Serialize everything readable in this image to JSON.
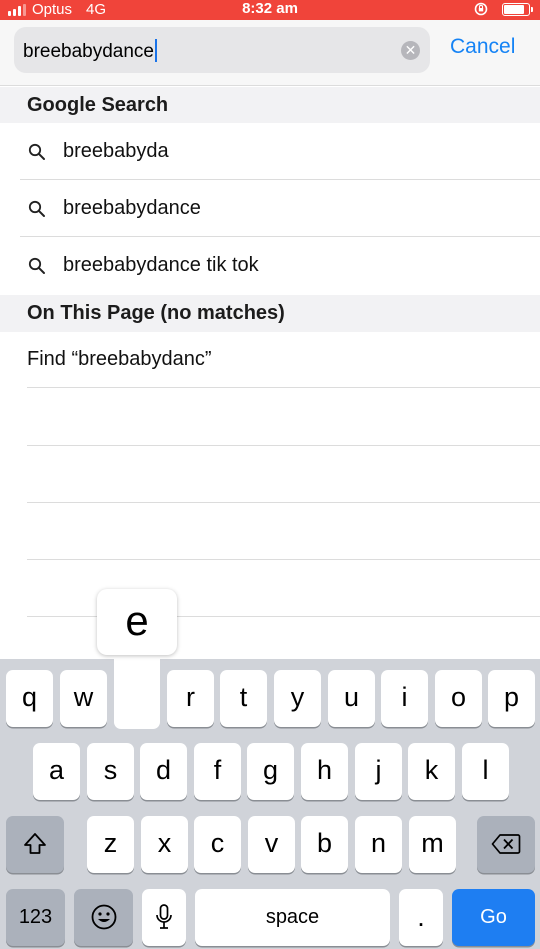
{
  "status_bar": {
    "carrier": "Optus",
    "network": "4G",
    "time": "8:32 am",
    "battery_level": 0.85,
    "background_color": "#f0443a"
  },
  "search": {
    "query": "breebabydance",
    "cancel_label": "Cancel",
    "clear_icon": "clear-icon"
  },
  "google_section": {
    "title": "Google Search",
    "suggestions": [
      {
        "label": "breebabyda",
        "icon": "search-icon"
      },
      {
        "label": "breebabydance",
        "icon": "search-icon"
      },
      {
        "label": "breebabydance tik tok",
        "icon": "search-icon"
      }
    ]
  },
  "page_section": {
    "title": "On This Page (no matches)",
    "find_label": "Find “breebabydanc”"
  },
  "keyboard": {
    "popup_key": "e",
    "row1": [
      "q",
      "w",
      "e",
      "r",
      "t",
      "y",
      "u",
      "i",
      "o",
      "p"
    ],
    "row2": [
      "a",
      "s",
      "d",
      "f",
      "g",
      "h",
      "j",
      "k",
      "l"
    ],
    "row3": [
      "z",
      "x",
      "c",
      "v",
      "b",
      "n",
      "m"
    ],
    "numbers_label": "123",
    "space_label": "space",
    "period_label": ".",
    "go_label": "Go",
    "icons": {
      "shift": "shift-icon",
      "delete": "delete-icon",
      "emoji": "emoji-icon",
      "mic": "microphone-icon"
    },
    "accent_color": "#1e7ef2"
  }
}
